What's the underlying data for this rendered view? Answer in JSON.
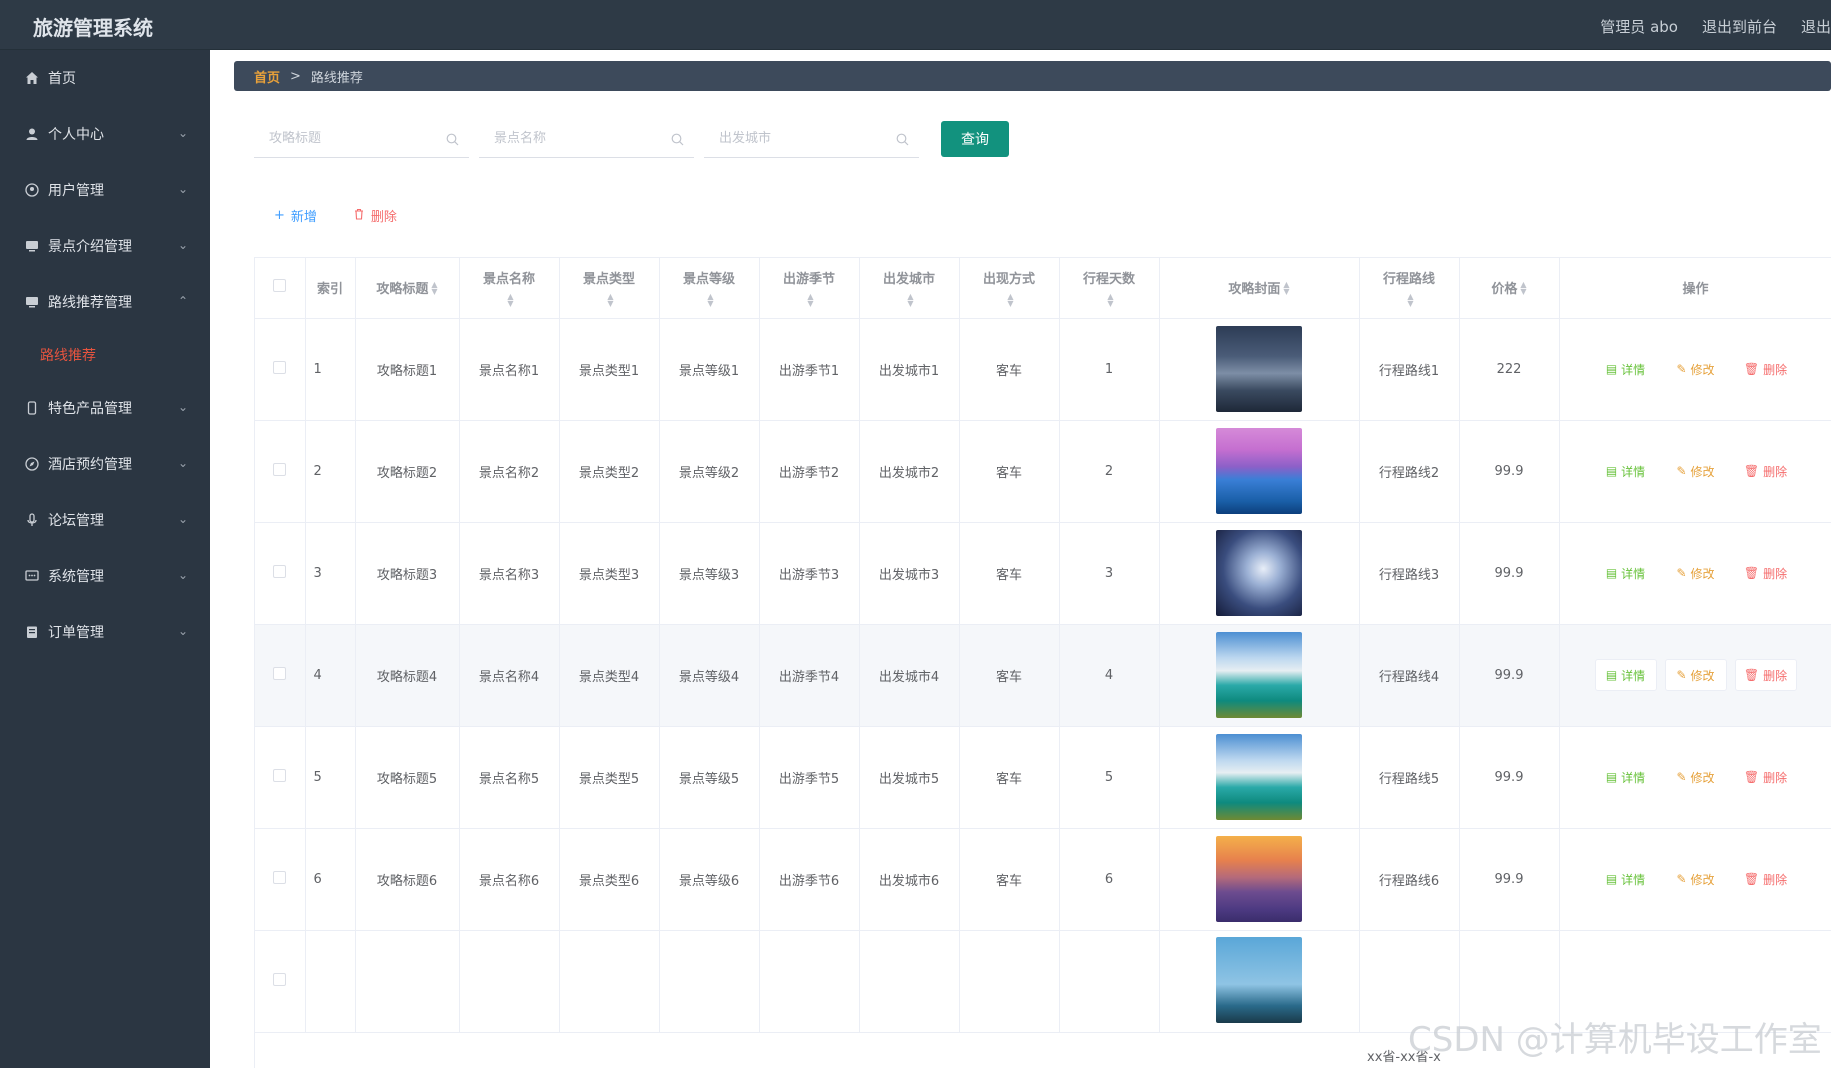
{
  "header": {
    "app_title": "旅游管理系统",
    "admin_label": "管理员 abo",
    "front_label": "退出到前台",
    "logout_label": "退出"
  },
  "sidebar": {
    "items": [
      {
        "label": "首页",
        "icon": "home-icon",
        "expandable": false
      },
      {
        "label": "个人中心",
        "icon": "user-icon",
        "expandable": true
      },
      {
        "label": "用户管理",
        "icon": "circle-user-icon",
        "expandable": true
      },
      {
        "label": "景点介绍管理",
        "icon": "monitor-icon",
        "expandable": true
      },
      {
        "label": "路线推荐管理",
        "icon": "monitor-icon",
        "expandable": true,
        "open": true
      },
      {
        "label": "特色产品管理",
        "icon": "phone-icon",
        "expandable": true
      },
      {
        "label": "酒店预约管理",
        "icon": "compass-icon",
        "expandable": true
      },
      {
        "label": "论坛管理",
        "icon": "mic-icon",
        "expandable": true
      },
      {
        "label": "系统管理",
        "icon": "chat-icon",
        "expandable": true
      },
      {
        "label": "订单管理",
        "icon": "document-icon",
        "expandable": true
      }
    ],
    "sub_item": "路线推荐"
  },
  "breadcrumb": {
    "home": "首页",
    "separator": ">",
    "current": "路线推荐"
  },
  "search": {
    "title_placeholder": "攻略标题",
    "spot_placeholder": "景点名称",
    "city_placeholder": "出发城市",
    "query_label": "查询"
  },
  "actions": {
    "add_label": "新增",
    "delete_label": "删除"
  },
  "table": {
    "headers": {
      "index": "索引",
      "title": "攻略标题",
      "spot_name": "景点名称",
      "spot_type": "景点类型",
      "spot_level": "景点等级",
      "season": "出游季节",
      "city": "出发城市",
      "transport": "出现方式",
      "days": "行程天数",
      "cover": "攻略封面",
      "route": "行程路线",
      "price": "价格",
      "ops": "操作"
    },
    "op_labels": {
      "detail": "详情",
      "edit": "修改",
      "delete": "删除"
    },
    "rows": [
      {
        "index": "1",
        "title": "攻略标题1",
        "spot_name": "景点名称1",
        "spot_type": "景点类型1",
        "spot_level": "景点等级1",
        "season": "出游季节1",
        "city": "出发城市1",
        "transport": "客车",
        "days": "1",
        "route": "行程路线1",
        "price": "222"
      },
      {
        "index": "2",
        "title": "攻略标题2",
        "spot_name": "景点名称2",
        "spot_type": "景点类型2",
        "spot_level": "景点等级2",
        "season": "出游季节2",
        "city": "出发城市2",
        "transport": "客车",
        "days": "2",
        "route": "行程路线2",
        "price": "99.9"
      },
      {
        "index": "3",
        "title": "攻略标题3",
        "spot_name": "景点名称3",
        "spot_type": "景点类型3",
        "spot_level": "景点等级3",
        "season": "出游季节3",
        "city": "出发城市3",
        "transport": "客车",
        "days": "3",
        "route": "行程路线3",
        "price": "99.9"
      },
      {
        "index": "4",
        "title": "攻略标题4",
        "spot_name": "景点名称4",
        "spot_type": "景点类型4",
        "spot_level": "景点等级4",
        "season": "出游季节4",
        "city": "出发城市4",
        "transport": "客车",
        "days": "4",
        "route": "行程路线4",
        "price": "99.9"
      },
      {
        "index": "5",
        "title": "攻略标题5",
        "spot_name": "景点名称5",
        "spot_type": "景点类型5",
        "spot_level": "景点等级5",
        "season": "出游季节5",
        "city": "出发城市5",
        "transport": "客车",
        "days": "5",
        "route": "行程路线5",
        "price": "99.9"
      },
      {
        "index": "6",
        "title": "攻略标题6",
        "spot_name": "景点名称6",
        "spot_type": "景点类型6",
        "spot_level": "景点等级6",
        "season": "出游季节6",
        "city": "出发城市6",
        "transport": "客车",
        "days": "6",
        "route": "行程路线6",
        "price": "99.9"
      }
    ],
    "partial_route": "xx省-xx省-x"
  },
  "watermark": "CSDN @计算机毕设工作室",
  "colors": {
    "topbar": "#2e3a46",
    "sidebar": "#2b3642",
    "accent": "#12927e",
    "active_sub": "#e6543f",
    "breadcrumb_home": "#e8a13a"
  }
}
